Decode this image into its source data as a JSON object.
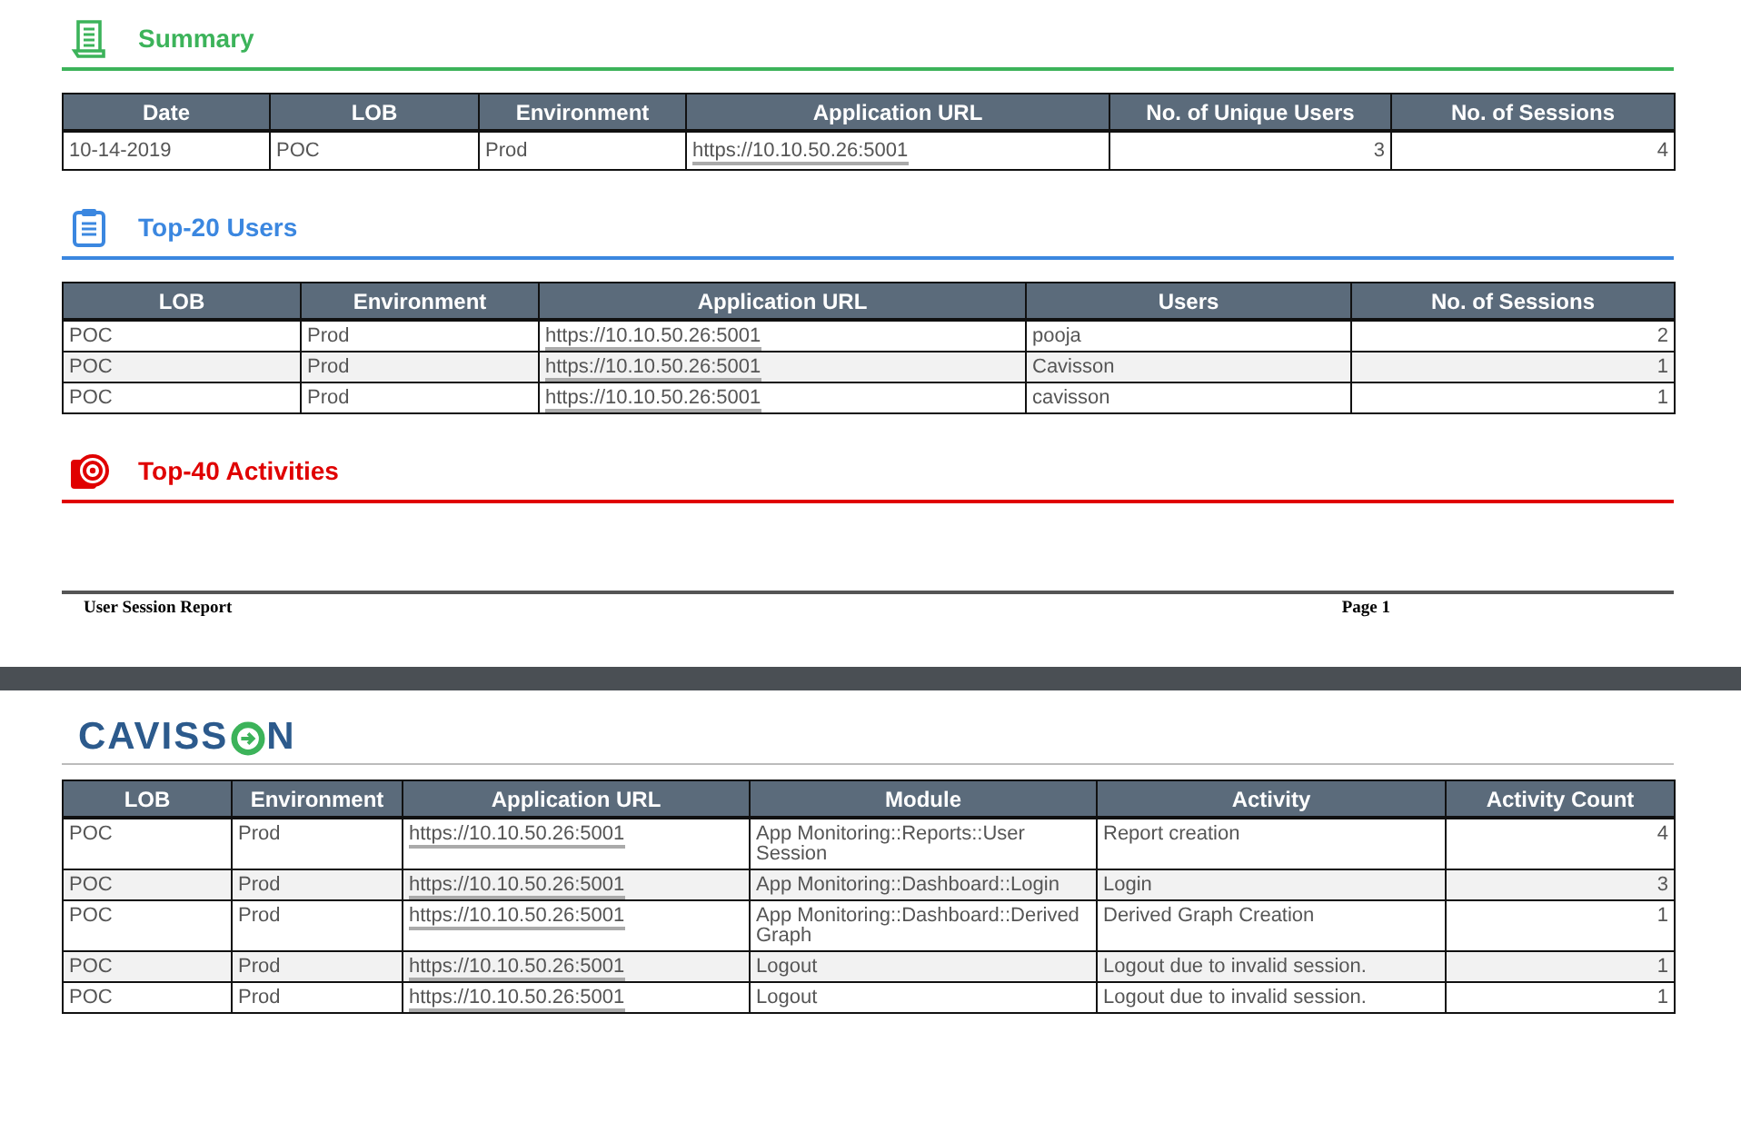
{
  "pages": [
    {
      "sections": [
        {
          "kind": "scroll",
          "color": "#3cb35a",
          "title": "Summary",
          "table": {
            "columns": [
              {
                "label": "Date",
                "kind": "text"
              },
              {
                "label": "LOB",
                "kind": "text"
              },
              {
                "label": "Environment",
                "kind": "text"
              },
              {
                "label": "Application URL",
                "kind": "url"
              },
              {
                "label": "No. of Unique Users",
                "kind": "number"
              },
              {
                "label": "No. of Sessions",
                "kind": "number"
              }
            ],
            "rows": [
              [
                "10-14-2019",
                "POC",
                "Prod",
                "https://10.10.50.26:5001",
                "3",
                "4"
              ]
            ]
          }
        },
        {
          "kind": "clipboard",
          "color": "#3b87e0",
          "title": "Top-20 Users",
          "table": {
            "columns": [
              {
                "label": "LOB",
                "kind": "text"
              },
              {
                "label": "Environment",
                "kind": "text"
              },
              {
                "label": "Application URL",
                "kind": "url"
              },
              {
                "label": "Users",
                "kind": "text"
              },
              {
                "label": "No. of Sessions",
                "kind": "number"
              }
            ],
            "rows": [
              [
                "POC",
                "Prod",
                "https://10.10.50.26:5001",
                "pooja",
                "2"
              ],
              [
                "POC",
                "Prod",
                "https://10.10.50.26:5001",
                "Cavisson",
                "1"
              ],
              [
                "POC",
                "Prod",
                "https://10.10.50.26:5001",
                "cavisson",
                "1"
              ]
            ]
          }
        },
        {
          "kind": "target",
          "color": "#e00000",
          "title": "Top-40 Activities"
        }
      ],
      "footer": {
        "title": "User Session Report",
        "page": "Page 1"
      }
    },
    {
      "logo": {
        "before": "CAVISS",
        "after": "N"
      },
      "sections": [
        {
          "table": {
            "columns": [
              {
                "label": "LOB",
                "kind": "text"
              },
              {
                "label": "Environment",
                "kind": "text"
              },
              {
                "label": "Application URL",
                "kind": "url"
              },
              {
                "label": "Module",
                "kind": "text"
              },
              {
                "label": "Activity",
                "kind": "text"
              },
              {
                "label": "Activity Count",
                "kind": "number"
              }
            ],
            "rows": [
              [
                "POC",
                "Prod",
                "https://10.10.50.26:5001",
                "App Monitoring::Reports::User Session",
                "Report creation",
                "4"
              ],
              [
                "POC",
                "Prod",
                "https://10.10.50.26:5001",
                "App Monitoring::Dashboard::Login",
                "Login",
                "3"
              ],
              [
                "POC",
                "Prod",
                "https://10.10.50.26:5001",
                "App Monitoring::Dashboard::Derived Graph",
                "Derived Graph Creation",
                "1"
              ],
              [
                "POC",
                "Prod",
                "https://10.10.50.26:5001",
                "Logout",
                "Logout due to invalid session.",
                "1"
              ],
              [
                "POC",
                "Prod",
                "https://10.10.50.26:5001",
                "Logout",
                "Logout due to invalid session.",
                "1"
              ]
            ]
          }
        }
      ]
    }
  ]
}
